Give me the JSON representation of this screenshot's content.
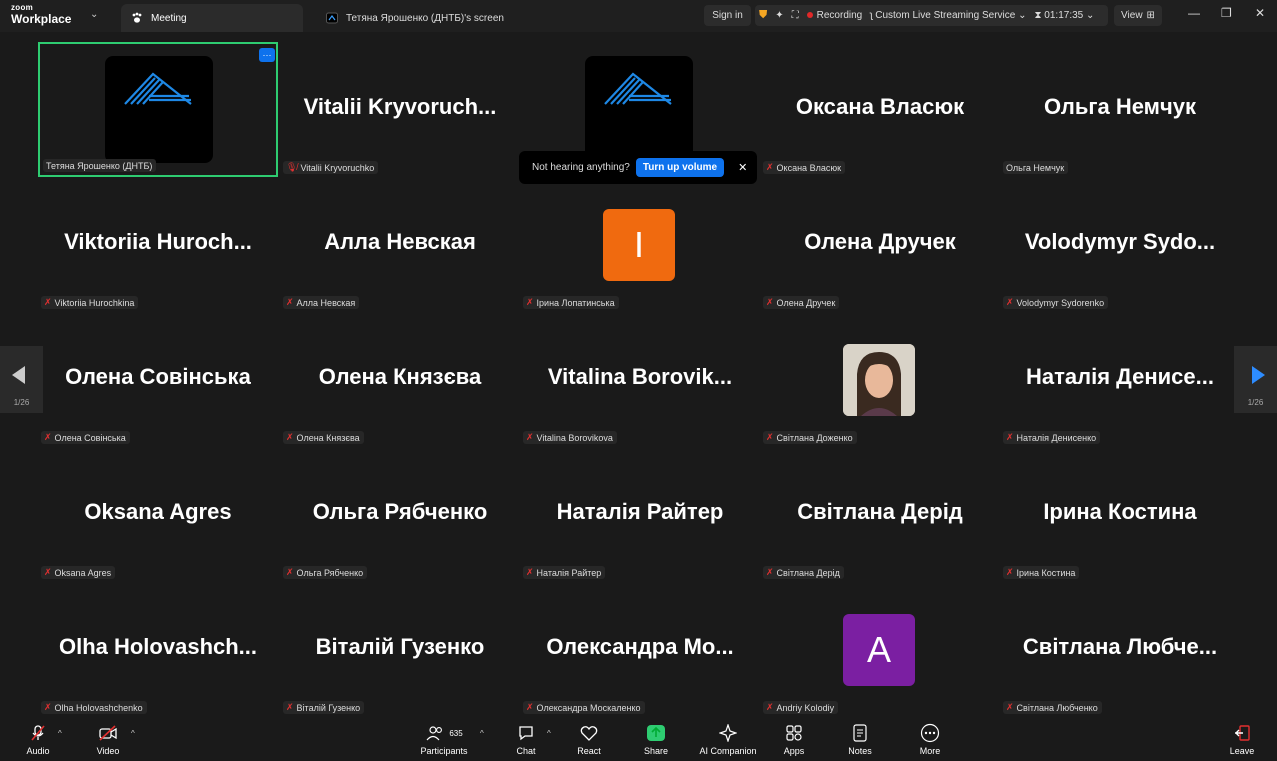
{
  "app": {
    "brand_top": "zoom",
    "brand_bottom": "Workplace"
  },
  "tabs": [
    {
      "label": "Meeting"
    },
    {
      "label": "Тетяна Ярошенко (ДНТБ)'s screen"
    }
  ],
  "titlebar": {
    "sign_in": "Sign in",
    "recording": "Recording",
    "streaming": "Custom Live Streaming Service",
    "timer": "01:17:35",
    "view": "View"
  },
  "toast": {
    "text": "Not hearing anything?",
    "button": "Turn up volume",
    "close": "✕"
  },
  "pager": {
    "left": "1/26",
    "right": "1/26"
  },
  "participants": [
    {
      "tile_name": "",
      "label": "Тетяна Ярошенко (ДНТБ)"
    },
    {
      "tile_name": "Vitalii  Kryvoruch...",
      "label": "Vitalii Kryvoruchko"
    },
    {
      "tile_name": "",
      "label": "Not hearing anything?"
    },
    {
      "tile_name": "Оксана Власюк",
      "label": "Оксана Власюк"
    },
    {
      "tile_name": "Ольга Немчук",
      "label": "Ольга Немчук"
    },
    {
      "tile_name": "Viktoriia  Huroch...",
      "label": "Viktoriia Hurochkina"
    },
    {
      "tile_name": "Алла Невская",
      "label": "Алла Невская"
    },
    {
      "tile_name": "I",
      "label": "Ірина Лопатинська"
    },
    {
      "tile_name": "Олена Дручек",
      "label": "Олена Дручек"
    },
    {
      "tile_name": "Volodymyr  Sydo...",
      "label": "Volodymyr Sydorenko"
    },
    {
      "tile_name": "Олена Совінська",
      "label": "Олена Совінська"
    },
    {
      "tile_name": "Олена Князєва",
      "label": "Олена Князєва"
    },
    {
      "tile_name": "Vitalina  Borovik...",
      "label": "Vitalina Borovikova"
    },
    {
      "tile_name": "",
      "label": "Світлана Доженко"
    },
    {
      "tile_name": "Наталія Денисе...",
      "label": "Наталія Денисенко"
    },
    {
      "tile_name": "Oksana Agres",
      "label": "Oksana Agres"
    },
    {
      "tile_name": "Ольга Рябченко",
      "label": "Ольга Рябченко"
    },
    {
      "tile_name": "Наталія Райтер",
      "label": "Наталія Райтер"
    },
    {
      "tile_name": "Світлана Дерід",
      "label": "Світлана Дерід"
    },
    {
      "tile_name": "Ірина Костина",
      "label": "Ірина Костина"
    },
    {
      "tile_name": "Olha  Holovashch...",
      "label": "Olha Holovashchenko"
    },
    {
      "tile_name": "Віталій Гузенко",
      "label": "Віталій Гузенко"
    },
    {
      "tile_name": "Олександра  Мо...",
      "label": "Олександра Москаленко"
    },
    {
      "tile_name": "A",
      "label": "Andriy Kolodiy"
    },
    {
      "tile_name": "Світлана  Любче...",
      "label": "Світлана Любченко"
    }
  ],
  "toolbar": {
    "audio": "Audio",
    "video": "Video",
    "participants": "Participants",
    "participants_count": "635",
    "chat": "Chat",
    "react": "React",
    "share": "Share",
    "ai_companion": "AI Companion",
    "apps": "Apps",
    "notes": "Notes",
    "more": "More",
    "leave": "Leave"
  },
  "colors": {
    "active_border": "#2ecc71",
    "accent_blue": "#0e72ed",
    "avatar_orange": "#f06a0f",
    "avatar_purple": "#7b1fa2",
    "muted_red": "#e23030"
  }
}
